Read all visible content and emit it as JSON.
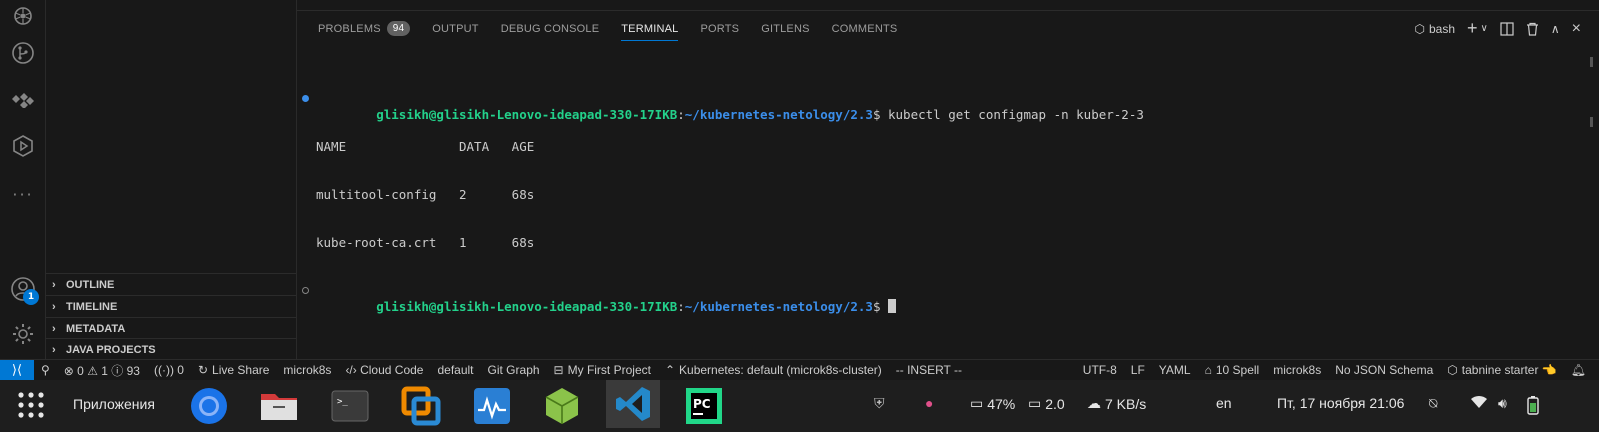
{
  "sidebar": {
    "sections": [
      {
        "label": "OUTLINE"
      },
      {
        "label": "TIMELINE"
      },
      {
        "label": "METADATA"
      },
      {
        "label": "JAVA PROJECTS"
      }
    ]
  },
  "activity": {
    "accounts_badge": "1"
  },
  "panel": {
    "tabs": [
      {
        "label": "PROBLEMS",
        "count": "94"
      },
      {
        "label": "OUTPUT"
      },
      {
        "label": "DEBUG CONSOLE"
      },
      {
        "label": "TERMINAL",
        "active": true
      },
      {
        "label": "PORTS"
      },
      {
        "label": "GITLENS"
      },
      {
        "label": "COMMENTS"
      }
    ],
    "shell_label": "bash"
  },
  "terminal": {
    "prompt_user": "glisikh@glisikh-Lenovo-ideapad-330-17IKB",
    "prompt_sep": ":",
    "prompt_path": "~/kubernetes-netology/2.3",
    "prompt_end": "$ ",
    "command": "kubectl get configmap -n kuber-2-3",
    "output": [
      "NAME               DATA   AGE",
      "multitool-config   2      68s",
      "kube-root-ca.crt   1      68s"
    ]
  },
  "statusbar": {
    "left": [
      {
        "icon": "run-errors-icon",
        "text": ""
      },
      {
        "icon": "error-icon",
        "text": "⊗ 0 ⚠ 1 ⓘ 93"
      },
      {
        "icon": "broadcast-icon",
        "text": "((·)) 0"
      },
      {
        "icon": "live-share-icon",
        "text": "Live Share"
      },
      {
        "icon": "",
        "text": "microk8s"
      },
      {
        "icon": "code-icon",
        "text": "‹/› Cloud Code"
      },
      {
        "icon": "",
        "text": "default"
      },
      {
        "icon": "",
        "text": "Git Graph"
      },
      {
        "icon": "project-icon",
        "text": "My First Project"
      },
      {
        "icon": "kubernetes-icon",
        "text": "Kubernetes: default (microk8s-cluster)"
      },
      {
        "icon": "",
        "text": "-- INSERT --"
      }
    ],
    "right": [
      {
        "text": "UTF-8"
      },
      {
        "text": "LF"
      },
      {
        "text": "YAML"
      },
      {
        "text": "10 Spell"
      },
      {
        "text": "microk8s"
      },
      {
        "text": "No JSON Schema"
      },
      {
        "text": "tabnine starter 👈"
      }
    ]
  },
  "taskbar": {
    "apps_label": "Приложения",
    "cpu": "47%",
    "load": "2.0",
    "net": "7 KB/s",
    "lang": "en",
    "datetime": "Пт, 17 ноября  21:06"
  },
  "colors": {
    "accent": "#0078d4",
    "prompt_user": "#23d18b",
    "prompt_path": "#3b8eea"
  }
}
